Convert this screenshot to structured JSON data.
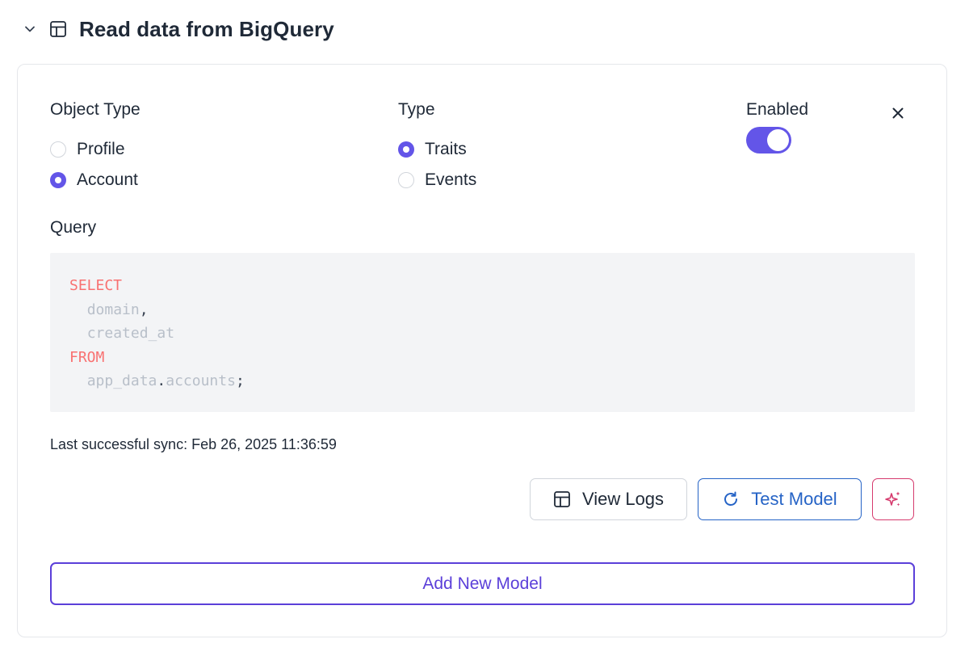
{
  "header": {
    "title": "Read data from BigQuery",
    "collapse_icon": "chevron-down-icon",
    "title_icon": "table-icon"
  },
  "object_type": {
    "label": "Object Type",
    "options": [
      {
        "label": "Profile",
        "checked": false
      },
      {
        "label": "Account",
        "checked": true
      }
    ]
  },
  "type": {
    "label": "Type",
    "options": [
      {
        "label": "Traits",
        "checked": true
      },
      {
        "label": "Events",
        "checked": false
      }
    ]
  },
  "enabled": {
    "label": "Enabled",
    "value": true
  },
  "query": {
    "label": "Query",
    "lines": [
      {
        "kw": "SELECT"
      },
      {
        "ident": "domain",
        "punct": ","
      },
      {
        "ident": "created_at"
      },
      {
        "kw": "FROM"
      },
      {
        "ident_a": "app_data",
        "dot": ".",
        "ident_b": "accounts",
        "semi": ";"
      }
    ]
  },
  "sync": {
    "text": "Last successful sync: Feb 26, 2025 11:36:59"
  },
  "buttons": {
    "view_logs": "View Logs",
    "test_model": "Test Model",
    "ai_icon": "sparkles-icon",
    "add_new_model": "Add New Model"
  },
  "colors": {
    "accent": "#6355e8",
    "test_blue": "#2563c6",
    "ai_pink": "#d63b6e",
    "sql_keyword": "#f87171"
  }
}
